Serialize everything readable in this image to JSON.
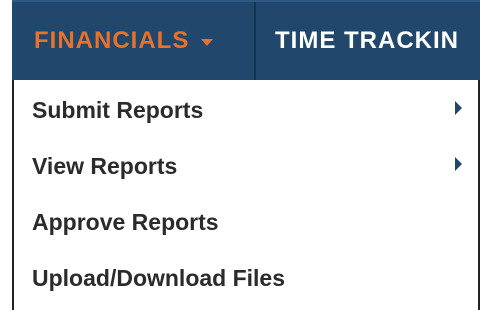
{
  "nav": {
    "active_tab": {
      "label": "FINANCIALS",
      "icon": "caret-down-icon",
      "color": "#e8712c"
    },
    "other_tab": {
      "label": "TIME TRACKIN",
      "color": "#ffffff"
    },
    "background_color": "#21476c"
  },
  "menu": {
    "items": [
      {
        "label": "Submit Reports",
        "icon": "chevron-right-icon"
      },
      {
        "label": "View Reports",
        "icon": "chevron-right-icon"
      },
      {
        "label": "Approve Reports"
      },
      {
        "label": "Upload/Download Files"
      }
    ]
  }
}
